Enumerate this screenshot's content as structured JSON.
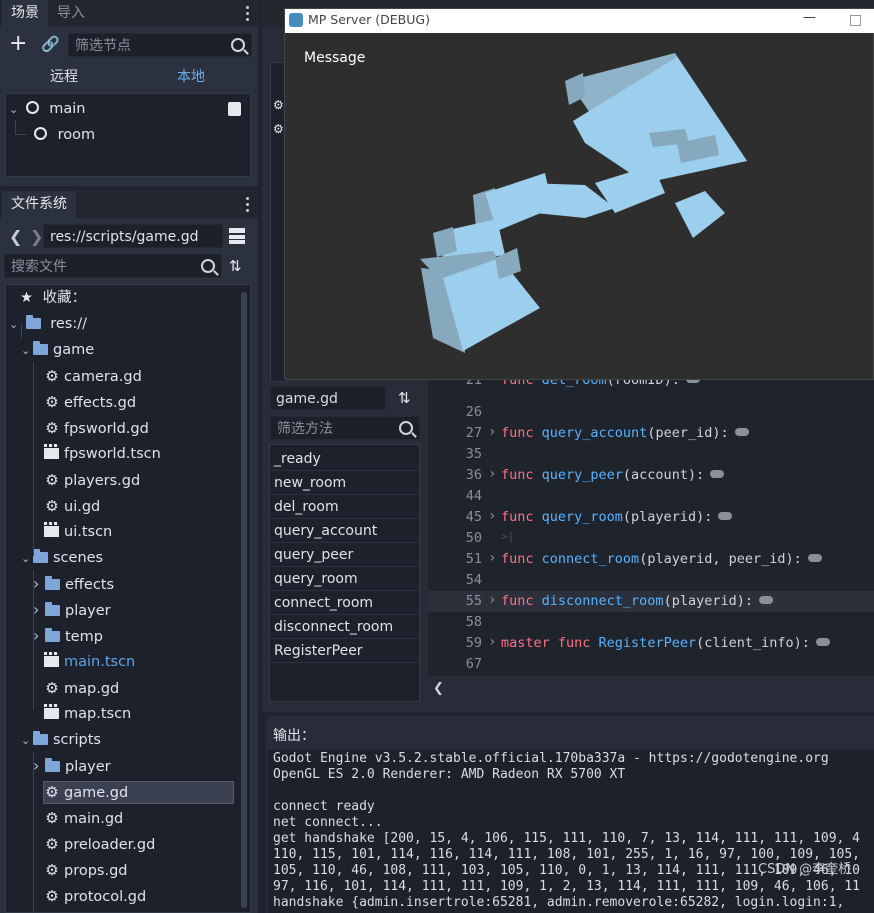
{
  "scene_dock": {
    "tabs": [
      "场景",
      "导入"
    ],
    "filter_placeholder": "筛选节点",
    "modes": [
      "远程",
      "本地"
    ],
    "nodes": [
      {
        "label": "main"
      },
      {
        "label": "room"
      }
    ]
  },
  "filesystem": {
    "tab": "文件系统",
    "path": "res://scripts/game.gd",
    "search_placeholder": "搜索文件",
    "favorites": "收藏：",
    "root": "res://",
    "items": [
      {
        "label": "game",
        "type": "folder",
        "depth": 1,
        "open": true
      },
      {
        "label": "camera.gd",
        "type": "script",
        "depth": 2
      },
      {
        "label": "effects.gd",
        "type": "script",
        "depth": 2
      },
      {
        "label": "fpsworld.gd",
        "type": "script",
        "depth": 2
      },
      {
        "label": "fpsworld.tscn",
        "type": "scene",
        "depth": 2
      },
      {
        "label": "players.gd",
        "type": "script",
        "depth": 2
      },
      {
        "label": "ui.gd",
        "type": "script",
        "depth": 2
      },
      {
        "label": "ui.tscn",
        "type": "scene",
        "depth": 2
      },
      {
        "label": "scenes",
        "type": "folder",
        "depth": 1,
        "open": true
      },
      {
        "label": "effects",
        "type": "folder",
        "depth": 2,
        "open": false
      },
      {
        "label": "player",
        "type": "folder",
        "depth": 2,
        "open": false
      },
      {
        "label": "temp",
        "type": "folder",
        "depth": 2,
        "open": false
      },
      {
        "label": "main.tscn",
        "type": "scene",
        "depth": 2,
        "highlight": true
      },
      {
        "label": "map.gd",
        "type": "script",
        "depth": 2
      },
      {
        "label": "map.tscn",
        "type": "scene",
        "depth": 2
      },
      {
        "label": "scripts",
        "type": "folder",
        "depth": 1,
        "open": true
      },
      {
        "label": "player",
        "type": "folder",
        "depth": 2,
        "open": false
      },
      {
        "label": "game.gd",
        "type": "script",
        "depth": 2,
        "selected": true
      },
      {
        "label": "main.gd",
        "type": "script",
        "depth": 2
      },
      {
        "label": "preloader.gd",
        "type": "script",
        "depth": 2
      },
      {
        "label": "props.gd",
        "type": "script",
        "depth": 2
      },
      {
        "label": "protocol.gd",
        "type": "script",
        "depth": 2
      }
    ]
  },
  "debug_window": {
    "title": "MP Server (DEBUG)",
    "message": "Message",
    "minimize_glyph": "—"
  },
  "script_panel": {
    "current_script": "game.gd",
    "filter_methods_placeholder": "筛选方法",
    "methods": [
      "_ready",
      "new_room",
      "del_room",
      "query_account",
      "query_peer",
      "query_room",
      "connect_room",
      "disconnect_room",
      "RegisterPeer"
    ]
  },
  "code": {
    "lines": [
      {
        "num": "21",
        "partial": true,
        "kw": "func ",
        "fn": "del_room",
        "rest": "(roomID):",
        "folded": true
      },
      {
        "num": "26"
      },
      {
        "num": "27",
        "kw": "func ",
        "fn": "query_account",
        "rest": "(peer_id):",
        "folded": true
      },
      {
        "num": "35"
      },
      {
        "num": "36",
        "kw": "func ",
        "fn": "query_peer",
        "rest": "(account):",
        "folded": true
      },
      {
        "num": "44"
      },
      {
        "num": "45",
        "kw": "func ",
        "fn": "query_room",
        "rest": "(playerid):",
        "folded": true
      },
      {
        "num": "50",
        "tab": ">|"
      },
      {
        "num": "51",
        "kw": "func ",
        "fn": "connect_room",
        "rest": "(playerid, peer_id):",
        "folded": true
      },
      {
        "num": "54"
      },
      {
        "num": "55",
        "kw": "func ",
        "fn": "disconnect_room",
        "rest": "(playerid):",
        "folded": true,
        "current": true
      },
      {
        "num": "58"
      },
      {
        "num": "59",
        "kw": "master func ",
        "fn": "RegisterPeer",
        "rest": "(client_info):",
        "folded": true
      },
      {
        "num": "67"
      }
    ]
  },
  "output": {
    "title": "输出：",
    "lines": [
      "Godot Engine v3.5.2.stable.official.170ba337a - https://godotengine.org",
      "OpenGL ES 2.0 Renderer: AMD Radeon RX 5700 XT",
      "",
      "connect ready",
      "net connect...",
      "get handshake [200, 15, 4, 106, 115, 111, 110, 7, 13, 114, 111, 111, 109, 4",
      "110, 115, 101, 114, 116, 114, 111, 108, 101, 255, 1, 16, 97, 100, 109, 105,",
      "105, 110, 46, 108, 111, 103, 105, 110, 0, 1, 13, 114, 111, 111, 109, 46, 10",
      "97, 116, 101, 114, 111, 111, 109, 1, 2, 13, 114, 111, 111, 109, 46, 106, 11",
      "handshake   {admin.insertrole:65281, admin.removerole:65282, login.login:1,"
    ],
    "watermark": "CSDN @李奎桥"
  },
  "colors": {
    "editor_bg": "#1f2430",
    "panel": "#272c38",
    "keyword": "#ff7085",
    "function": "#57b3ff",
    "highlight_text": "#5fa3e8",
    "mesh": "#9ccfee"
  }
}
